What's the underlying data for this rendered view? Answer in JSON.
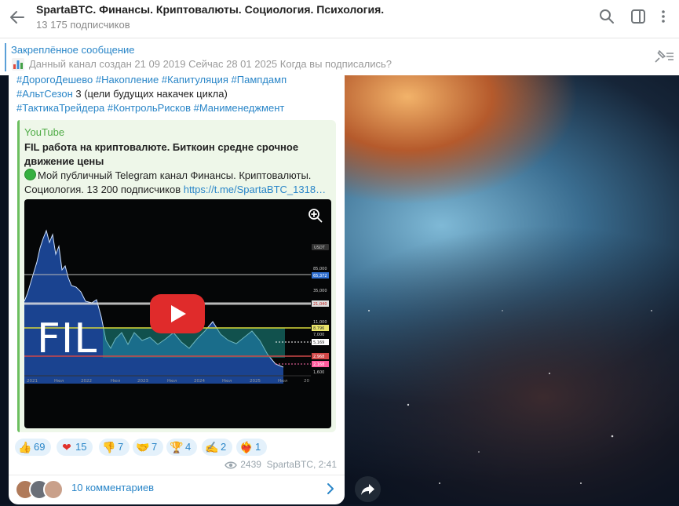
{
  "header": {
    "title": "SpartaBTC. Финансы. Криптовалюты. Социология. Психология.",
    "subscribers": "13 175 подписчиков"
  },
  "pinned": {
    "title": "Закреплённое сообщение",
    "text": "Данный канал создан 21 09 2019 Сейчас 28 01 2025 Когда вы подписались?"
  },
  "message": {
    "hashtags_line1": "#ДорогоДешево #Накопление #Капитуляция #Пампдамп",
    "hashtags_line2_tag": "#АльтСезон",
    "hashtags_line2_text": " 3 (цели будущих накачек цикла)",
    "hashtags_line3": "#ТактикаТрейдера #КонтрольРисков #Манименеджмент",
    "preview": {
      "site": "YouTube",
      "title": "FIL работа на криптовалюте.  Биткоин средне срочное движение цены",
      "desc_text": "Мой публичный Telegram канал Финансы. Криптовалюты. Социология. 13 200 подписчиков ",
      "desc_link": "https://t.me/SpartaBTC_1318…",
      "video_label": "FIL",
      "chart_ticks_x": [
        "2021",
        "Нюл",
        "2022",
        "Нюл",
        "2023",
        "Нюл",
        "2024",
        "Нюл",
        "2025",
        "Нюл",
        "20"
      ],
      "chart_ticks_y": [
        "85,000",
        "65,372",
        "35,000",
        "21,040",
        "11,000",
        "8,796",
        "7,000",
        "5,169",
        "2,968",
        "2,168",
        "1,600"
      ],
      "chart_currency": "USDT"
    },
    "reactions": [
      {
        "emoji": "👍",
        "count": "69"
      },
      {
        "emoji": "❤",
        "count": "15"
      },
      {
        "emoji": "👎",
        "count": "7"
      },
      {
        "emoji": "🤝",
        "count": "7"
      },
      {
        "emoji": "🏆",
        "count": "4"
      },
      {
        "emoji": "✍",
        "count": "2"
      },
      {
        "emoji": "❤‍🔥",
        "count": "1"
      }
    ],
    "views": "2439",
    "author_time": "SpartaBTC, 2:41",
    "comments_label": "10 комментариев"
  },
  "colors": {
    "accent": "#2a86c8",
    "preview_green": "#4eab45",
    "play_red": "#e02b2b"
  }
}
